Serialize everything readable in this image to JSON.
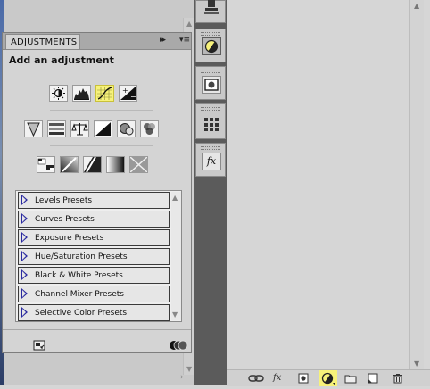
{
  "adjustments_panel": {
    "tab_label": "ADJUSTMENTS",
    "collapse_glyph": "▸▸",
    "menu_glyph": "▾≡",
    "subtitle": "Add an adjustment",
    "icon_rows": [
      [
        "brightness-contrast-icon",
        "levels-icon",
        "curves-icon",
        "exposure-icon"
      ],
      [
        "vibrance-icon",
        "hue-saturation-icon",
        "color-balance-icon",
        "black-white-icon",
        "photo-filter-icon",
        "channel-mixer-icon"
      ],
      [
        "invert-icon",
        "posterize-icon",
        "threshold-icon",
        "gradient-map-icon",
        "selective-color-icon"
      ]
    ],
    "active_icon": "curves-icon",
    "presets": [
      "Levels Presets",
      "Curves Presets",
      "Exposure Presets",
      "Hue/Saturation Presets",
      "Black & White Presets",
      "Channel Mixer Presets",
      "Selective Color Presets"
    ]
  },
  "colors": {
    "highlight": "#f7f27a",
    "tool_column": "#5b5b5b",
    "panel_bg": "#d4d4d4"
  },
  "layers_footer": {
    "fx_label": "fx"
  },
  "tool_column": {
    "fx_label": "fx"
  }
}
